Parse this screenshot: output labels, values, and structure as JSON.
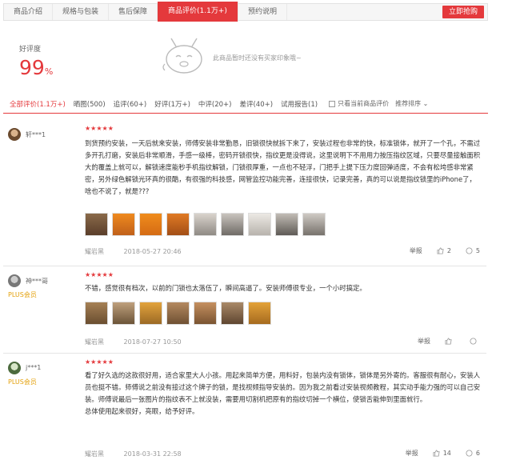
{
  "tabs": [
    {
      "label": "商品介绍"
    },
    {
      "label": "规格与包装"
    },
    {
      "label": "售后保障"
    },
    {
      "label": "商品评价(1.1万+)"
    },
    {
      "label": "预约说明"
    }
  ],
  "buy_button": "立即抢购",
  "summary": {
    "rate_label": "好评度",
    "rate_value": "99",
    "rate_unit": "%",
    "no_impression": "此商品暂时还没有买家印象哦~"
  },
  "filters": [
    {
      "label": "全部评价(1.1万+)"
    },
    {
      "label": "晒图(500)"
    },
    {
      "label": "追评(60+)"
    },
    {
      "label": "好评(1万+)"
    },
    {
      "label": "中评(20+)"
    },
    {
      "label": "差评(40+)"
    },
    {
      "label": "试用报告(1)"
    }
  ],
  "only_current": "只看当前商品评价",
  "sort_label": "推荐排序",
  "reviews": [
    {
      "username": "轩***1",
      "plus": "",
      "stars": "★★★★★",
      "content": "到货预约安装，一天后就来安装，师傅安装非常勤恳，旧锁很快就拆下来了，安装过程也非常的快，标准锁体，就开了一个孔，不需过多开孔打磨，安装后非常顺滑，手感一级棒，密码开锁很快，指纹更是没得说，这里说明下不用用力按压指纹区域，只要尽量接触面积大的覆盖上就可以，解锁速度能秒手机指纹解锁，门锁很厚重，一点也不轻浮，门把手上提下压力度回弹适度，不会有松垮感非常紧密，另外绿色解锁光环真的很酷，有很强的科技感，网管监控功能完善，连接很快，记录完善，真的可以说是指纹锁里的iPhone了，啥也不说了，就是???",
      "date": "2018-05-27 20:46",
      "color": "耀岩黑",
      "report": "举报",
      "likes": "2",
      "replies": "5"
    },
    {
      "username": "神***哥",
      "plus": "PLUS会员",
      "stars": "★★★★★",
      "content": "不错，感觉很有档次，以前的门锁也太落伍了，瞬间高逼了。安装师傅很专业，一个小时搞定。",
      "date": "2018-07-27 10:50",
      "color": "耀岩黑",
      "report": "举报",
      "likes": "",
      "replies": ""
    },
    {
      "username": "j***1",
      "plus": "PLUS会员",
      "stars": "★★★★★",
      "content": "看了好久选的这款很好用，适合家里大人小孩。用起来简单方便，用料好，包装内没有锁体，锁体是另外寄的。客服很有耐心，安装人员也挺不错。师傅说之前没有接过这个牌子的锁，是找视频指导安装的。因为我之前看过安装视频教程，其实动手能力强的可以自己安装。师傅说最后一张图片的指纹表不上就没装，需要用切割机把原有的指纹切掉一个横位，使锁舌能伸到里面就行。\n总体使用起来很好，亮眼，给予好评。",
      "date": "2018-03-31 22:58",
      "color": "耀岩黑",
      "report": "举报",
      "likes": "14",
      "replies": "6"
    }
  ]
}
